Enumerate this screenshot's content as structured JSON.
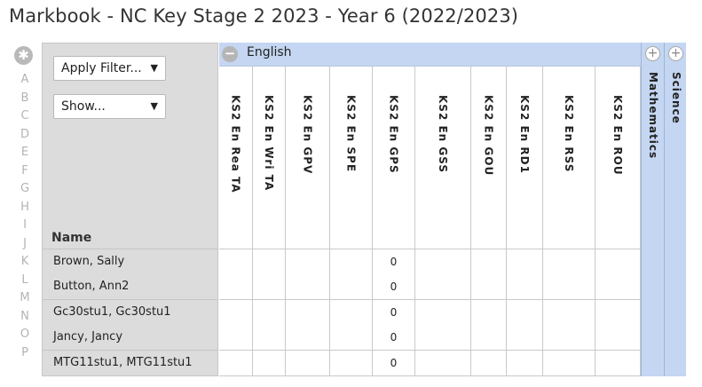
{
  "title": "Markbook - NC Key Stage 2 2023 - Year 6 (2022/2023)",
  "settings_icon": "gear-icon",
  "row_letters": [
    "A",
    "B",
    "C",
    "D",
    "E",
    "F",
    "G",
    "H",
    "I",
    "J",
    "K",
    "L",
    "M",
    "N",
    "O",
    "P"
  ],
  "filters": {
    "apply_filter": "Apply Filter...",
    "show": "Show..."
  },
  "name_header": "Name",
  "group": {
    "label": "English",
    "collapse_symbol": "−"
  },
  "columns": [
    "KS2 En Rea TA",
    "KS2 En Wri TA",
    "KS2 En GPV",
    "KS2 En SPE",
    "KS2 En GPS",
    "KS2 En GSS",
    "KS2 En GOU",
    "KS2 En RD1",
    "KS2 En RSS",
    "KS2 En ROU"
  ],
  "collapsed_groups": [
    {
      "label": "Mathematics",
      "expand_symbol": "+"
    },
    {
      "label": "Science",
      "expand_symbol": "+"
    }
  ],
  "students": [
    {
      "name": "Brown, Sally",
      "values": [
        "",
        "",
        "",
        "",
        "0",
        "",
        "",
        "",
        "",
        ""
      ]
    },
    {
      "name": "Button, Ann2",
      "values": [
        "",
        "",
        "",
        "",
        "0",
        "",
        "",
        "",
        "",
        ""
      ]
    },
    {
      "name": "Gc30stu1, Gc30stu1",
      "values": [
        "",
        "",
        "",
        "",
        "0",
        "",
        "",
        "",
        "",
        ""
      ]
    },
    {
      "name": "Jancy, Jancy",
      "values": [
        "",
        "",
        "",
        "",
        "0",
        "",
        "",
        "",
        "",
        ""
      ]
    },
    {
      "name": "MTG11stu1, MTG11stu1",
      "values": [
        "",
        "",
        "",
        "",
        "0",
        "",
        "",
        "",
        "",
        ""
      ]
    }
  ],
  "colors": {
    "group_band": "#c4d6f1",
    "name_column": "#dcdcdc"
  }
}
